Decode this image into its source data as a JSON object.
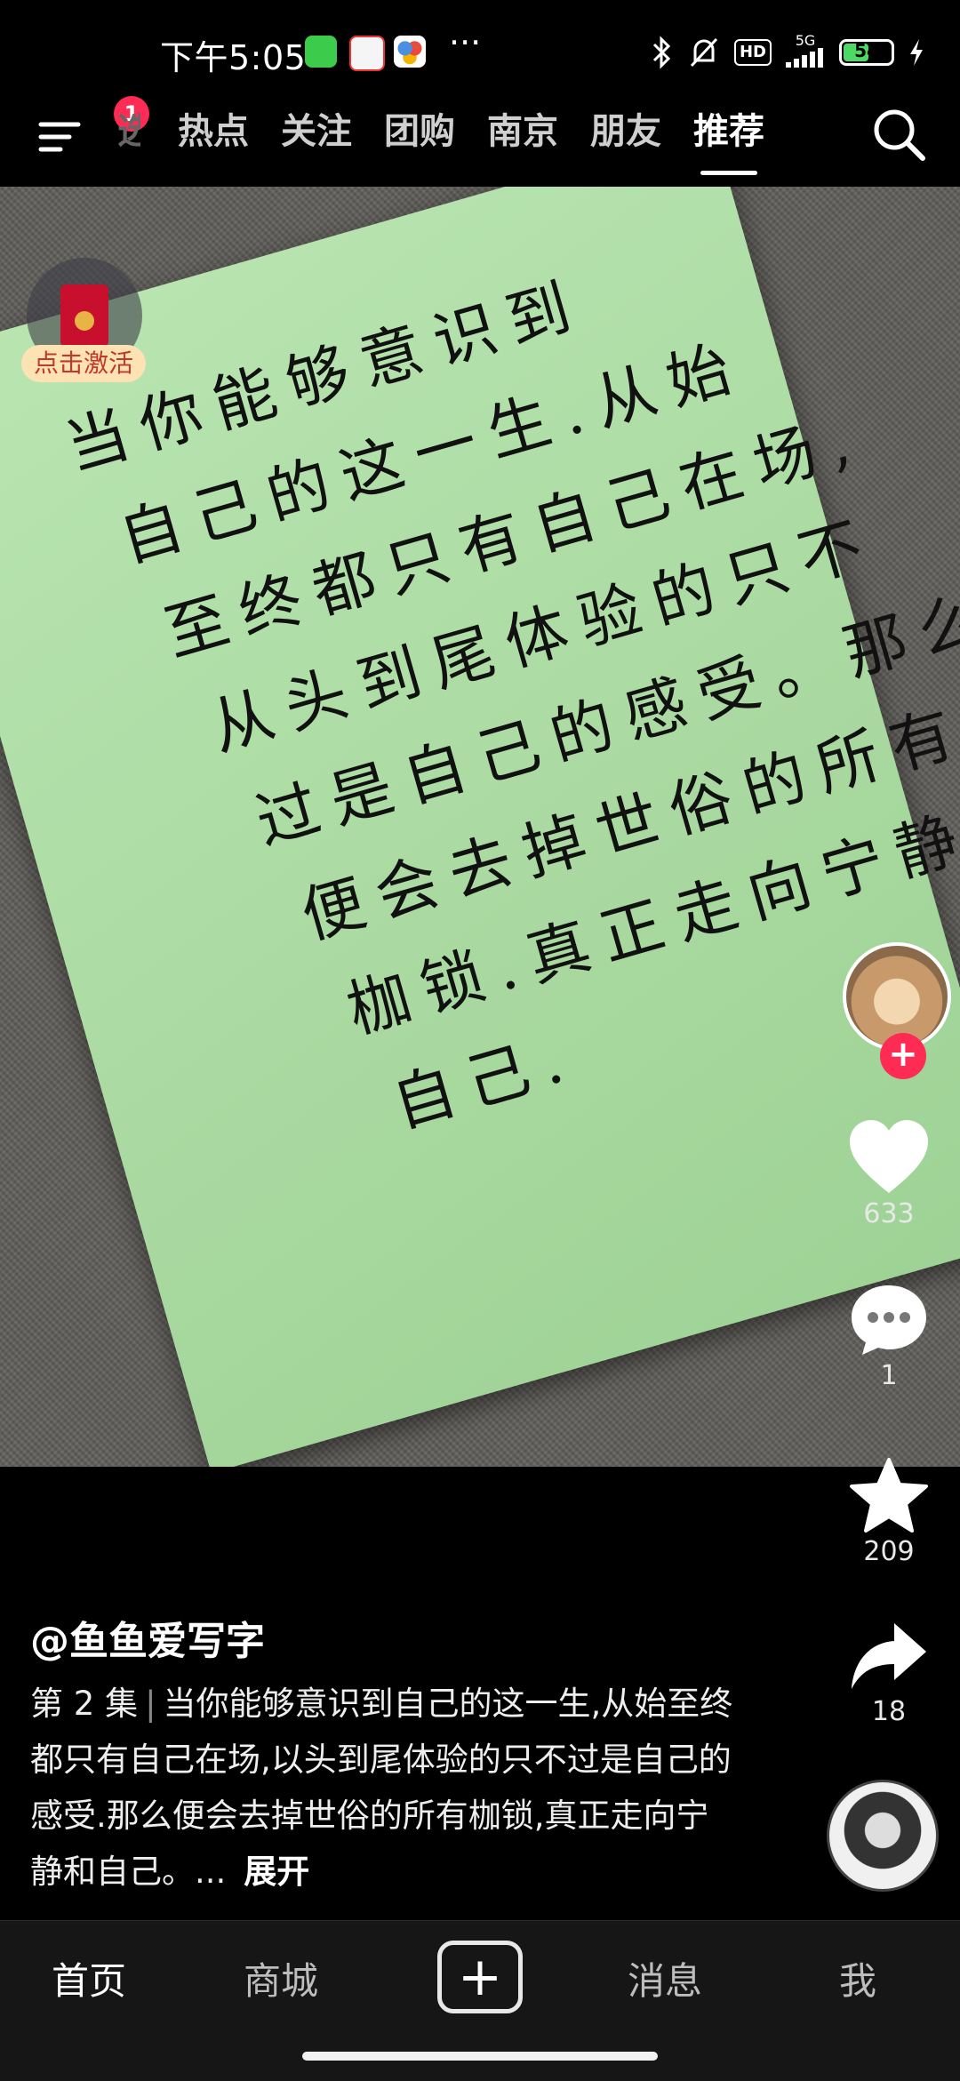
{
  "status_bar": {
    "time": "下午5:05",
    "more": "···",
    "hd": "HD",
    "network": "5G",
    "battery": "54",
    "battery_level": 0.54
  },
  "top_nav": {
    "badge": "1",
    "partial_tab": "选",
    "tabs": [
      "热点",
      "关注",
      "团购",
      "南京",
      "朋友",
      "推荐"
    ],
    "active_tab": "推荐"
  },
  "pendant": {
    "label": "点击激活"
  },
  "video": {
    "handwriting_lines": [
      "当你能够意识到",
      "自己的这一生.从始",
      "至终都只有自己在场,",
      "从头到尾体验的只不",
      "过是自己的感受。那么",
      "便会去掉世俗的所有",
      "枷锁.真正走向宁静",
      "自己."
    ]
  },
  "rail": {
    "likes": "633",
    "comments": "1",
    "favorites": "209",
    "shares": "18"
  },
  "caption": {
    "author": "@鱼鱼爱写字",
    "episode": "第 2 集",
    "separator": "|",
    "text": "当你能够意识到自己的这一生,从始至终都只有自己在场,以头到尾体验的只不过是自己的感受.那么便会去掉世俗的所有枷锁,真正走向宁静和自己。...",
    "expand": "展开"
  },
  "bottom_nav": {
    "home": "首页",
    "mall": "商城",
    "add": "+",
    "messages": "消息",
    "me": "我"
  },
  "colors": {
    "accent": "#fe2c55",
    "paper": "#b4e2ab",
    "background": "#000000"
  }
}
